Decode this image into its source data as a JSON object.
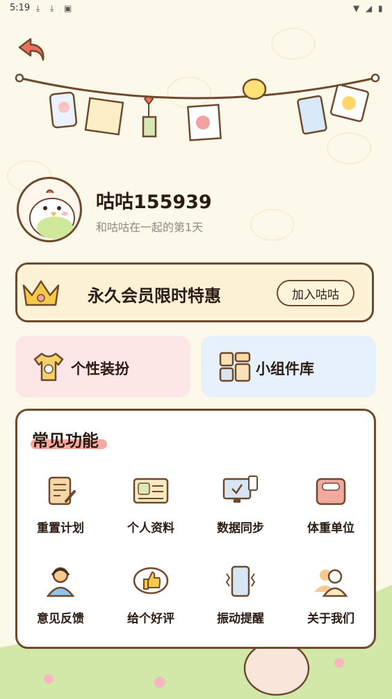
{
  "status_bar": {
    "time": "5:19"
  },
  "profile": {
    "name": "咕咕155939",
    "subtitle": "和咕咕在一起的第1天"
  },
  "vip": {
    "title": "永久会员限时特惠",
    "button_label": "加入咕咕"
  },
  "cards": {
    "dressup_label": "个性装扮",
    "widgets_label": "小组件库"
  },
  "functions": {
    "title": "常见功能",
    "items": [
      {
        "label": "重置计划",
        "icon": "document-pen-icon"
      },
      {
        "label": "个人资料",
        "icon": "id-card-icon"
      },
      {
        "label": "数据同步",
        "icon": "computer-sync-icon"
      },
      {
        "label": "体重单位",
        "icon": "scale-icon"
      },
      {
        "label": "意见反馈",
        "icon": "headset-person-icon"
      },
      {
        "label": "给个好评",
        "icon": "thumbs-up-icon"
      },
      {
        "label": "振动提醒",
        "icon": "phone-vibrate-icon"
      },
      {
        "label": "关于我们",
        "icon": "people-icon"
      }
    ]
  },
  "colors": {
    "background": "#FCF8EA",
    "border": "#6D4A2E",
    "pink_card": "#FCE7E6",
    "blue_card": "#E6F1FB",
    "highlight": "#F7A8A0",
    "back_arrow": "#E8725F"
  }
}
